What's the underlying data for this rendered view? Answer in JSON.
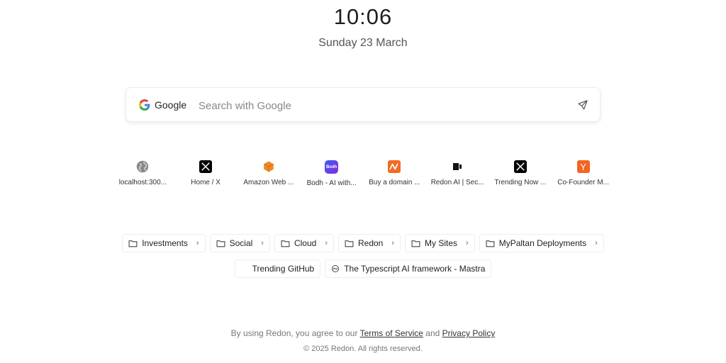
{
  "clock": {
    "time": "10:06",
    "date": "Sunday 23 March"
  },
  "search": {
    "engine_label": "Google",
    "placeholder": "Search with Google",
    "value": ""
  },
  "shortcuts": [
    {
      "label": "localhost:300...",
      "icon": "globe-icon"
    },
    {
      "label": "Home / X",
      "icon": "x-logo-icon"
    },
    {
      "label": "Amazon Web ...",
      "icon": "aws-cube-icon"
    },
    {
      "label": "Bodh - AI with...",
      "icon": "bodh-logo-icon",
      "icon_text": "Bodh"
    },
    {
      "label": "Buy a domain ...",
      "icon": "namecheap-logo-icon"
    },
    {
      "label": "Redon AI | Sec...",
      "icon": "redon-logo-icon"
    },
    {
      "label": "Trending Now ...",
      "icon": "x-logo-icon"
    },
    {
      "label": "Co-Founder M...",
      "icon": "ycombinator-logo-icon",
      "icon_text": "Y"
    }
  ],
  "folders": [
    {
      "label": "Investments",
      "icon": "folder-icon"
    },
    {
      "label": "Social",
      "icon": "folder-icon"
    },
    {
      "label": "Cloud",
      "icon": "folder-icon"
    },
    {
      "label": "Redon",
      "icon": "folder-icon"
    },
    {
      "label": "My Sites",
      "icon": "folder-icon"
    },
    {
      "label": "MyPaltan Deployments",
      "icon": "folder-icon"
    }
  ],
  "bookmarks": [
    {
      "label": "Trending GitHub",
      "icon": ""
    },
    {
      "label": "The Typescript AI framework - Mastra",
      "icon": "mastra-logo-icon"
    }
  ],
  "footer": {
    "prefix": "By using Redon, you agree to our",
    "terms": "Terms of Service",
    "and": "and",
    "privacy": "Privacy Policy",
    "copyright": "© 2025 Redon. All rights reserved."
  },
  "colors": {
    "aws_orange": "#f08a24",
    "namecheap_orange": "#f26a21",
    "yc_orange": "#f26522",
    "bodh_purple": "#6a3df0"
  }
}
